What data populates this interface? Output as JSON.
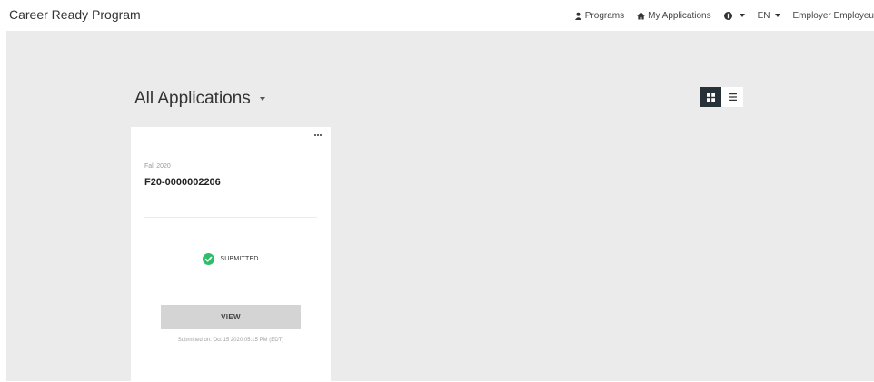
{
  "app": {
    "title": "Career Ready Program"
  },
  "nav": {
    "programs": "Programs",
    "my_applications": "My Applications",
    "help_icon": "info-circle-icon",
    "language": "EN",
    "user": "Employer Employeu"
  },
  "main": {
    "heading": "All Applications",
    "view_modes": [
      "grid",
      "list"
    ],
    "active_view": "grid"
  },
  "card": {
    "menu_icon": "ellipsis-icon",
    "term": "Fall 2020",
    "application_id": "F20-0000002206",
    "status": "SUBMITTED",
    "status_color": "#2ebd6b",
    "view_label": "VIEW",
    "submitted_on": "Submitted on: Oct 15 2020 05:15 PM (EDT)"
  },
  "colors": {
    "toggle_active": "#263238",
    "page_background": "#ebebeb"
  }
}
